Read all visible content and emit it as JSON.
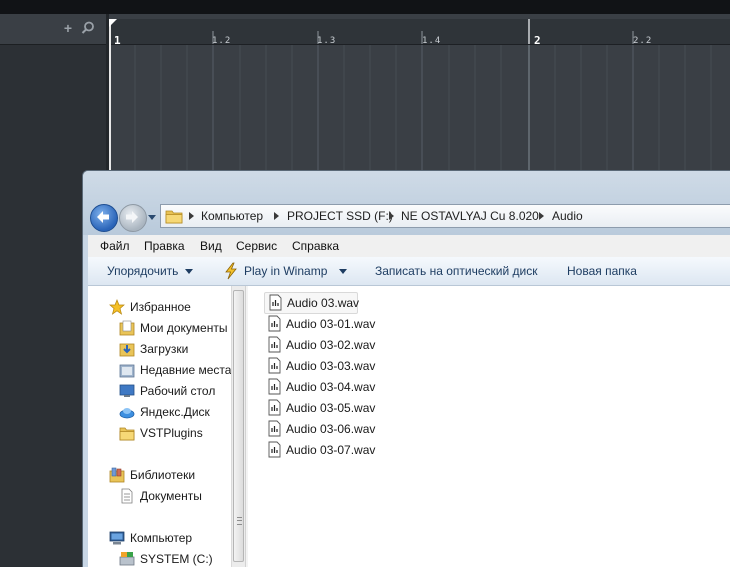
{
  "daw": {
    "ruler": {
      "labels": [
        "1",
        "1.2",
        "1.3",
        "1.4",
        "2",
        "2.2"
      ]
    }
  },
  "explorer": {
    "breadcrumb": [
      "Компьютер",
      "PROJECT SSD (F:)",
      "NE OSTAVLYAJ Cu 8.020",
      "Audio"
    ],
    "menu": [
      "Файл",
      "Правка",
      "Вид",
      "Сервис",
      "Справка"
    ],
    "toolbar": {
      "organize": "Упорядочить",
      "play_winamp": "Play in Winamp",
      "burn": "Записать на оптический диск",
      "new_folder": "Новая папка"
    },
    "nav": {
      "favorites": "Избранное",
      "my_documents": "Мои документы",
      "downloads": "Загрузки",
      "recent_places": "Недавние места",
      "desktop": "Рабочий стол",
      "yandex_disk": "Яндекс.Диск",
      "vstplugins": "VSTPlugins",
      "libraries": "Библиотеки",
      "documents": "Документы",
      "computer": "Компьютер",
      "system_c": "SYSTEM (C:)"
    },
    "files": [
      "Audio 03.wav",
      "Audio 03-01.wav",
      "Audio 03-02.wav",
      "Audio 03-03.wav",
      "Audio 03-04.wav",
      "Audio 03-05.wav",
      "Audio 03-06.wav",
      "Audio 03-07.wav"
    ]
  },
  "colors": {
    "daw_background": "#3a3f45",
    "daw_ruler": "#2f3439",
    "explorer_frame": "#c8d6e5",
    "toolbar_text": "#1e3d62"
  }
}
